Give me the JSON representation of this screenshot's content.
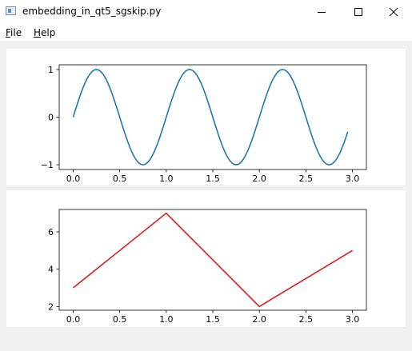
{
  "window": {
    "title": "embedding_in_qt5_sgskip.py",
    "icons": {
      "app": "app-window-icon",
      "minimize": "minimize-icon",
      "maximize": "maximize-icon",
      "close": "close-icon"
    }
  },
  "menu": {
    "items": [
      {
        "accel": "F",
        "rest": "ile"
      },
      {
        "accel": "H",
        "rest": "elp"
      }
    ]
  },
  "chart_data": [
    {
      "type": "line",
      "title": "",
      "xlabel": "",
      "ylabel": "",
      "xlim": [
        -0.15,
        3.15
      ],
      "ylim": [
        -1.1,
        1.1
      ],
      "xticks": [
        0.0,
        0.5,
        1.0,
        1.5,
        2.0,
        2.5,
        3.0
      ],
      "xtick_labels": [
        "0.0",
        "0.5",
        "1.0",
        "1.5",
        "2.0",
        "2.5",
        "3.0"
      ],
      "yticks": [
        1,
        0,
        -1
      ],
      "ytick_labels": [
        "1",
        "0",
        "−1"
      ],
      "series": [
        {
          "color": "#1f77b4",
          "function": "sin(2*pi*x)",
          "x_range": [
            0,
            2.95
          ]
        }
      ]
    },
    {
      "type": "line",
      "title": "",
      "xlabel": "",
      "ylabel": "",
      "xlim": [
        -0.15,
        3.15
      ],
      "ylim": [
        1.8,
        7.2
      ],
      "xticks": [
        0.0,
        0.5,
        1.0,
        1.5,
        2.0,
        2.5,
        3.0
      ],
      "xtick_labels": [
        "0.0",
        "0.5",
        "1.0",
        "1.5",
        "2.0",
        "2.5",
        "3.0"
      ],
      "yticks": [
        6,
        4,
        2
      ],
      "ytick_labels": [
        "6",
        "4",
        "2"
      ],
      "series": [
        {
          "color": "#e31a1c",
          "x": [
            0,
            1,
            2,
            3
          ],
          "y": [
            3,
            7,
            2,
            5
          ]
        }
      ]
    }
  ]
}
